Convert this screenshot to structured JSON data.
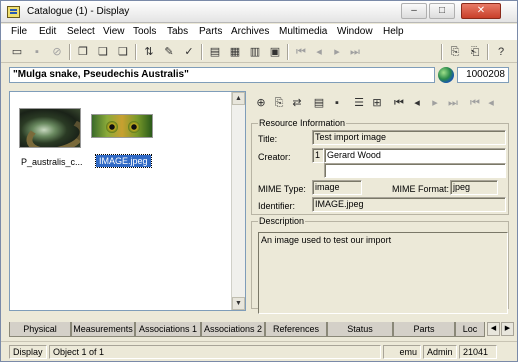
{
  "window": {
    "title": "Catalogue (1) - Display",
    "controls": {
      "minimize": "–",
      "maximize": "□",
      "close": "✕"
    }
  },
  "menu": [
    "File",
    "Edit",
    "Select",
    "View",
    "Tools",
    "Tabs",
    "Parts",
    "Archives",
    "Multimedia",
    "Window",
    "Help"
  ],
  "record": {
    "name": "\"Mulga snake, Pseudechis Australis\"",
    "irn": "1000208"
  },
  "thumbnails": [
    {
      "caption": "P_australis_c...",
      "selected": false
    },
    {
      "caption": "IMAGE.jpeg",
      "selected": true
    }
  ],
  "resource": {
    "group_label": "Resource Information",
    "title_label": "Title:",
    "title_value": "Test import image",
    "creator_label": "Creator:",
    "creator_index": "1",
    "creator_value": "Gerard Wood",
    "mime_type_label": "MIME Type:",
    "mime_type_value": "image",
    "mime_format_label": "MIME Format:",
    "mime_format_value": "jpeg",
    "identifier_label": "Identifier:",
    "identifier_value": "IMAGE.jpeg"
  },
  "description": {
    "group_label": "Description",
    "value": "An image used to test our import"
  },
  "tabs": [
    "Physical",
    "Measurements",
    "Associations 1",
    "Associations 2",
    "References",
    "Status",
    "Parts",
    "Loc"
  ],
  "status": {
    "mode": "Display",
    "object": "Object 1 of 1",
    "module": "emu",
    "user": "Admin",
    "count": "21041"
  }
}
